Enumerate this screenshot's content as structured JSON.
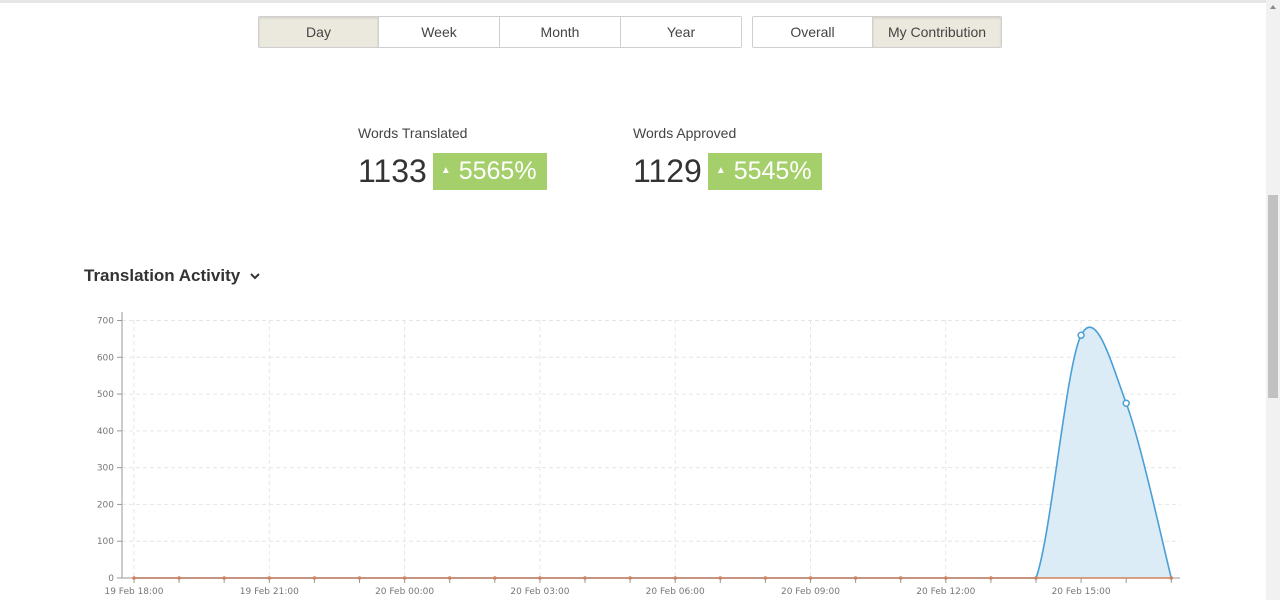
{
  "period_filter": {
    "options": [
      "Day",
      "Week",
      "Month",
      "Year"
    ],
    "selected": "Day"
  },
  "scope_filter": {
    "options": [
      "Overall",
      "My Contribution"
    ],
    "selected": "My Contribution"
  },
  "stats": {
    "words_translated": {
      "label": "Words Translated",
      "value": "1133",
      "change": "5565%"
    },
    "words_approved": {
      "label": "Words Approved",
      "value": "1129",
      "change": "5545%"
    }
  },
  "section": {
    "title": "Translation Activity"
  },
  "colors": {
    "badge": "#a5cf6a",
    "area_fill": "#dcecf7",
    "area_line": "#4a9fd6",
    "baseline": "#d0825f"
  },
  "chart_data": {
    "type": "area",
    "x_tick_labels": [
      "19 Feb 18:00",
      "19 Feb 21:00",
      "20 Feb 00:00",
      "20 Feb 03:00",
      "20 Feb 06:00",
      "20 Feb 09:00",
      "20 Feb 12:00",
      "20 Feb 15:00"
    ],
    "y_ticks": [
      0,
      100,
      200,
      300,
      400,
      500,
      600,
      700
    ],
    "ylim": [
      0,
      700
    ],
    "x_hours": [
      0,
      1,
      2,
      3,
      4,
      5,
      6,
      7,
      8,
      9,
      10,
      11,
      12,
      13,
      14,
      15,
      16,
      17,
      18,
      19,
      20,
      21,
      22,
      23
    ],
    "x_start": "19 Feb 18:00",
    "series": [
      {
        "name": "Words Translated",
        "values": [
          0,
          0,
          0,
          0,
          0,
          0,
          0,
          0,
          0,
          0,
          0,
          0,
          0,
          0,
          0,
          0,
          0,
          0,
          0,
          0,
          0,
          660,
          475,
          0
        ]
      },
      {
        "name": "Words Approved",
        "values": [
          0,
          0,
          0,
          0,
          0,
          0,
          0,
          0,
          0,
          0,
          0,
          0,
          0,
          0,
          0,
          0,
          0,
          0,
          0,
          0,
          0,
          0,
          0,
          0
        ]
      }
    ],
    "grid": true
  }
}
